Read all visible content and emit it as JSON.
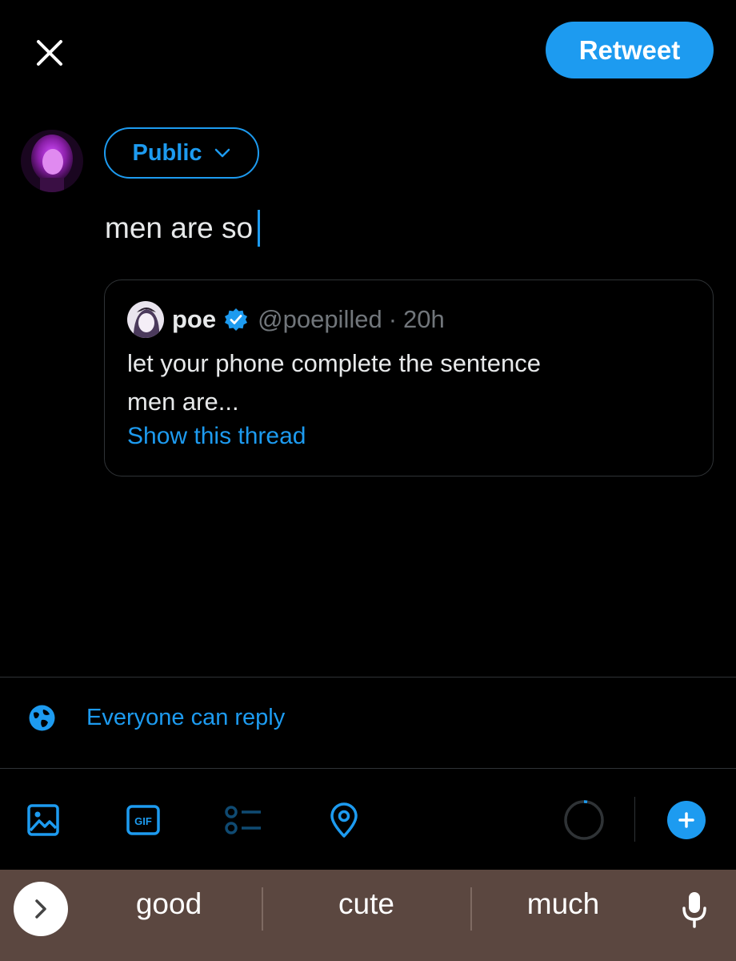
{
  "header": {
    "close_icon": "close-icon",
    "retweet_label": "Retweet"
  },
  "compose": {
    "audience_label": "Public",
    "text": "men are so"
  },
  "quote": {
    "name": "poe",
    "verified": true,
    "handle": "@poepilled",
    "separator": "·",
    "time": "20h",
    "body_line_1": "let your phone complete the sentence",
    "body_line_2": "men are...",
    "show_thread_label": "Show this thread"
  },
  "reply_setting": {
    "icon": "globe-icon",
    "label": "Everyone can reply"
  },
  "toolbar": {
    "icons": [
      "image-icon",
      "gif-icon",
      "poll-icon",
      "location-icon"
    ],
    "add_icon": "plus-icon",
    "counter": "character-counter-ring"
  },
  "keyboard": {
    "expand_icon": "chevron-right-icon",
    "suggestions": [
      "good",
      "cute",
      "much"
    ],
    "mic_icon": "microphone-icon"
  },
  "colors": {
    "accent": "#1d9bf0",
    "background": "#000000",
    "text_primary": "#e7e9ea",
    "text_secondary": "#71767b",
    "keyboard_bar": "#5b4740"
  }
}
